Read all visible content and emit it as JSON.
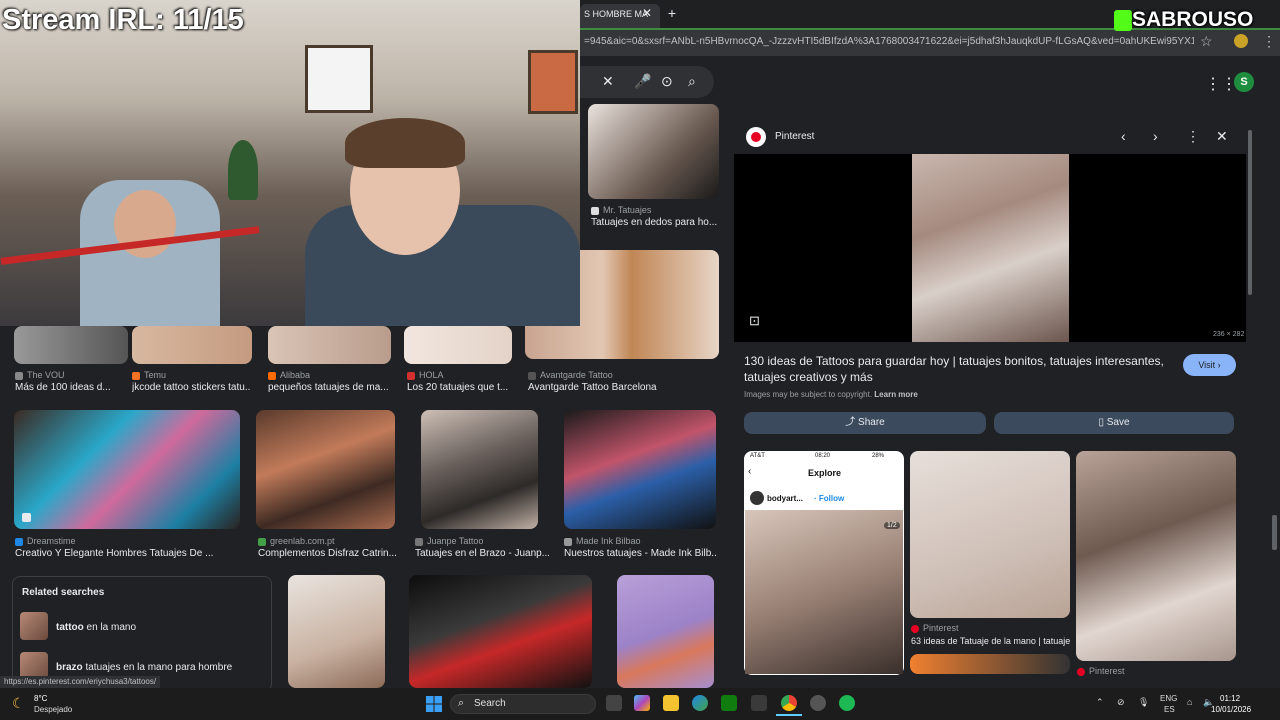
{
  "stream": {
    "title": "Stream IRL: 11/15",
    "brand": "SABROUSO"
  },
  "browser": {
    "tab_title": "S HOMBRE MA",
    "tab_close": "✕",
    "new_tab": "+",
    "url": "=945&aic=0&sxsrf=ANbL-n5HBvrnocQA_-JzzzvHTI5dBIfzdA%3A1768003471622&ei=j5dhaf3hJauqkdUP-fLGsAQ&ved=0ahUKEwi95YX1v-RAxUrVa...",
    "status_url": "https://es.pinterest.com/eriychusa3/tattoos/"
  },
  "search": {
    "clear_icon": "✕",
    "mic_icon": "🎤",
    "lens_icon": "⊙",
    "search_icon": "⌕"
  },
  "account": {
    "avatar_letter": "S"
  },
  "results": {
    "top_item": {
      "source": "Mr. Tatuajes",
      "title": "Tatuajes en dedos para ho..."
    },
    "row1": [
      {
        "source": "The VOU",
        "title": "Más de 100 ideas d...",
        "favicon_color": "#888888"
      },
      {
        "source": "Temu",
        "title": "jkcode tattoo stickers tatu...",
        "favicon_color": "#f57224"
      },
      {
        "source": "Alibaba",
        "title": "pequeños tatuajes de ma...",
        "favicon_color": "#ff6a00"
      },
      {
        "source": "HOLA",
        "title": "Los 20 tatuajes que t...",
        "favicon_color": "#d32f2f"
      },
      {
        "source": "Avantgarde Tattoo",
        "title": "Avantgarde Tattoo Barcelona",
        "favicon_color": "#555555"
      }
    ],
    "row2": [
      {
        "source": "Dreamstime",
        "title": "Creativo Y Elegante Hombres Tatuajes De ...",
        "favicon_color": "#1e88e5"
      },
      {
        "source": "greenlab.com.pt",
        "title": "Complementos Disfraz Catrin...",
        "favicon_color": "#43a047"
      },
      {
        "source": "Juanpe Tattoo",
        "title": "Tatuajes en el Brazo - Juanp...",
        "favicon_color": "#777777"
      },
      {
        "source": "Made Ink Bilbao",
        "title": "Nuestros tatuajes - Made Ink Bilb...",
        "favicon_color": "#999999"
      }
    ],
    "related": {
      "title": "Related searches",
      "items": [
        {
          "bold": "tattoo",
          "rest": " en la mano"
        },
        {
          "bold": "brazo",
          "rest": " tatuajes en la mano para hombre"
        }
      ]
    }
  },
  "preview": {
    "source": "Pinterest",
    "dimensions": "236 × 282",
    "title": "130 ideas de Tattoos para guardar hoy | tatuajes bonitos, tatuajes interesantes, tatuajes creativos y más",
    "visit_label": "Visit ›",
    "copyright_text": "Images may be subject to copyright.",
    "learn_more": "Learn more",
    "share_label": "Share",
    "save_label": "Save",
    "related_cards": [
      {
        "header": "Explore",
        "status_left": "AT&T",
        "status_time": "08:20",
        "status_right": "28%",
        "user": "bodyart...",
        "follow": "· Follow",
        "counter": "1/2"
      },
      {
        "source": "Pinterest",
        "title": "63 ideas de Tatuaje de la mano | tatuaje..."
      },
      {
        "source": "Pinterest"
      }
    ]
  },
  "taskbar": {
    "temp": "8°C",
    "weather": "Despejado",
    "search_label": "Search",
    "lang_top": "ENG",
    "lang_bottom": "ES",
    "time": "01:12",
    "date": "10/01/2026"
  }
}
